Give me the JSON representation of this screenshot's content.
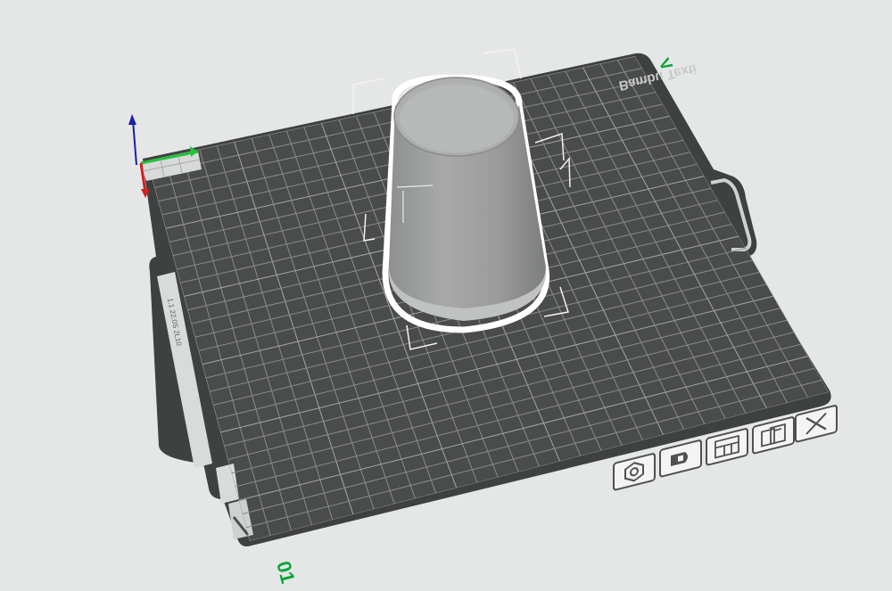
{
  "plate": {
    "brand_text": "Bambu Texti",
    "plate_number": "01",
    "corner_mark": "V",
    "sticker_line1": "1.1 22.0S 2L10",
    "sticker_line2": "MSL\n34.20"
  },
  "axes": {
    "x_color": "#22c33a",
    "y_color": "#d21f1f",
    "z_color": "#1a1fa8"
  },
  "colors": {
    "plate": "#4a4b4b",
    "grid": "#8a8b8b",
    "selection": "#ffffff",
    "accent": "#0aa33b"
  },
  "object": {
    "name": "cup",
    "selected": true
  },
  "toolbar": {
    "buttons": [
      {
        "name": "auto-orient-icon"
      },
      {
        "name": "plate-settings-icon"
      },
      {
        "name": "arrange-icon"
      },
      {
        "name": "lock-plate-icon"
      },
      {
        "name": "delete-plate-icon"
      }
    ]
  }
}
